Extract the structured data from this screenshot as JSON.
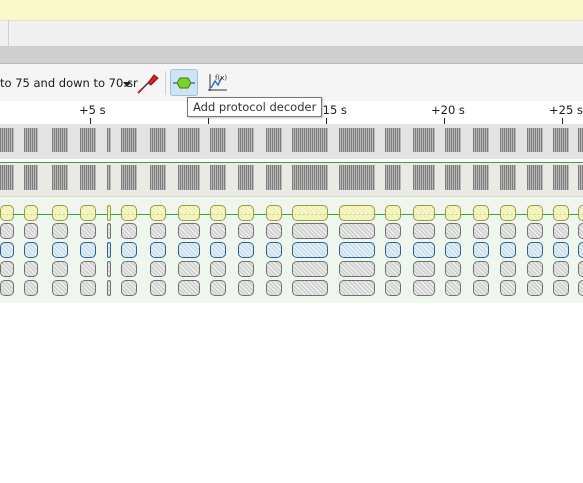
{
  "toolbar": {
    "session_name": "to 75 and down to 70.sr",
    "icons": [
      "session-dropdown",
      "probe-icon",
      "decoder-icon",
      "math-signal-icon"
    ],
    "tooltip": "Add protocol decoder"
  },
  "ruler": {
    "labels": [
      "+5 s",
      "+15 s",
      "+20 s",
      "+25 s"
    ]
  },
  "colors": {
    "banner": "#f8f8c9",
    "trace_line": "#3ba33b",
    "decoder_bg": "#eef6ee",
    "annotation_yellow": "#f2f0a6",
    "annotation_blue": "#c8dff0",
    "annotation_grey": "#d2d2d2"
  }
}
